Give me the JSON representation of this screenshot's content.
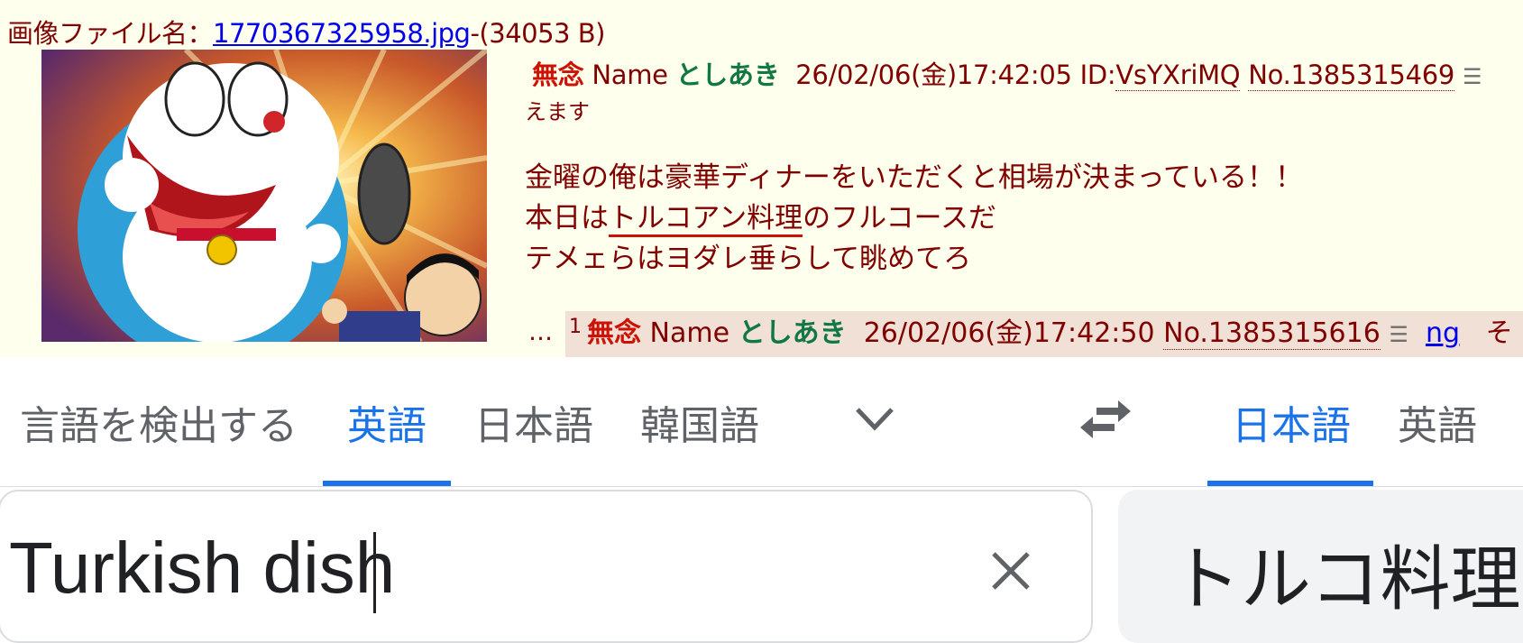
{
  "forum": {
    "file_prefix": "画像ファイル名：",
    "file_link": "1770367325958.jpg",
    "file_suffix": "-(34053 B)",
    "post": {
      "subject": "無念",
      "name_label": "Name",
      "name": "としあき",
      "datetime": "26/02/06(金)17:42:05",
      "id_prefix": "ID:",
      "id": "VsYXriMQ",
      "number": "No.1385315469",
      "menu_icon": "list-menu-icon",
      "sub_text": "えます",
      "body_line1": "金曜の俺は豪華ディナーをいただくと相場が決まっている！！",
      "body_line2_pre": "本日は",
      "body_line2_ul": "トルコアン料理",
      "body_line2_post": "のフルコースだ",
      "body_line3": "テメェらはヨダレ垂らして眺めてろ"
    },
    "reply": {
      "ellipsis": "…",
      "count": "1",
      "subject": "無念",
      "name_label": "Name",
      "name": "としあき",
      "datetime": "26/02/06(金)17:42:50",
      "number": "No.1385315616",
      "menu_icon": "list-menu-icon",
      "ng": "ng",
      "trail": "そ"
    }
  },
  "translate": {
    "source_tabs": [
      {
        "label": "言語を検出する"
      },
      {
        "label": "英語"
      },
      {
        "label": "日本語"
      },
      {
        "label": "韓国語"
      }
    ],
    "active_source_tab": "英語",
    "more_languages_icon": "chevron-down-icon",
    "swap_icon": "swap-icon",
    "target_tabs": [
      {
        "label": "日本語"
      },
      {
        "label": "英語"
      }
    ],
    "active_target_tab": "日本語",
    "source_text": "Turkish dish",
    "clear_icon": "close-icon",
    "target_text": "トルコ料理",
    "colors": {
      "accent": "#1a73e8",
      "text": "#202124",
      "muted": "#5f6368"
    }
  }
}
